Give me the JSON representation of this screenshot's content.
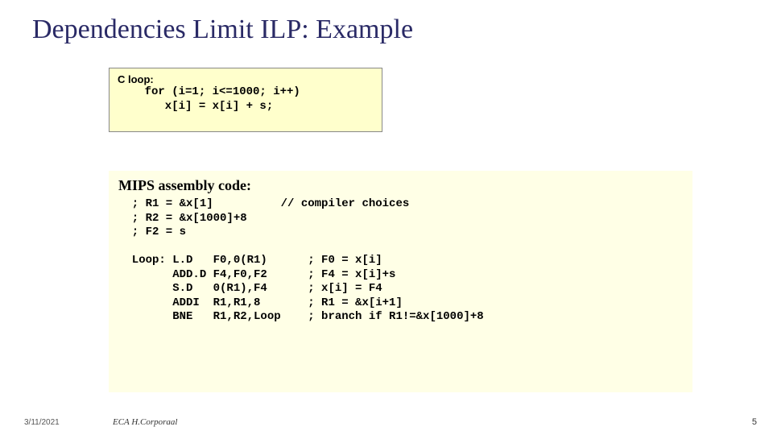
{
  "title": "Dependencies Limit ILP: Example",
  "cloop": {
    "label": "C loop:",
    "code": "    for (i=1; i<=1000; i++)\n       x[i] = x[i] + s;"
  },
  "mips": {
    "label": "MIPS assembly code:",
    "code": "  ; R1 = &x[1]          // compiler choices\n  ; R2 = &x[1000]+8\n  ; F2 = s\n\n  Loop: L.D   F0,0(R1)      ; F0 = x[i]\n        ADD.D F4,F0,F2      ; F4 = x[i]+s\n        S.D   0(R1),F4      ; x[i] = F4\n        ADDI  R1,R1,8       ; R1 = &x[i+1]\n        BNE   R1,R2,Loop    ; branch if R1!=&x[1000]+8"
  },
  "footer": {
    "date": "3/11/2021",
    "author": "ECA  H.Corporaal",
    "page": "5"
  }
}
